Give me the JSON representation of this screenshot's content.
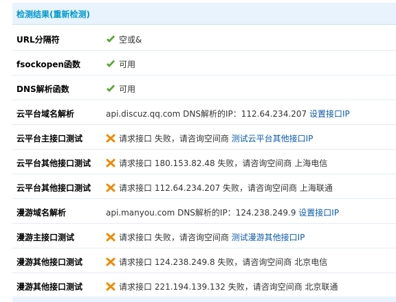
{
  "header": {
    "title_prefix": "检测结果(",
    "recheck_label": "重新检测",
    "title_suffix": ")"
  },
  "icons": {
    "ok": "check-icon",
    "fail": "cross-icon",
    "ok_color": "#5bb52b",
    "fail_color": "#f08a00"
  },
  "rows": [
    {
      "label": "URL分隔符",
      "status": "ok",
      "text": "空或&"
    },
    {
      "label": "fsockopen函数",
      "status": "ok",
      "text": "可用"
    },
    {
      "label": "DNS解析函数",
      "status": "ok",
      "text": "可用"
    },
    {
      "label": "云平台域名解析",
      "status": "none",
      "text": "api.discuz.qq.com DNS解析的IP：112.64.234.207 ",
      "link": "设置接口IP"
    },
    {
      "label": "云平台主接口测试",
      "status": "fail",
      "text": "请求接口 失败，请咨询空间商 ",
      "link": "测试云平台其他接口IP"
    },
    {
      "label": "云平台其他接口测试",
      "status": "fail",
      "text": "请求接口 180.153.82.48 失败，请咨询空间商 上海电信"
    },
    {
      "label": "云平台其他接口测试",
      "status": "fail",
      "text": "请求接口 112.64.234.207 失败，请咨询空间商 上海联通"
    },
    {
      "label": "漫游域名解析",
      "status": "none",
      "text": "api.manyou.com DNS解析的IP：124.238.249.9 ",
      "link": "设置接口IP"
    },
    {
      "label": "漫游主接口测试",
      "status": "fail",
      "text": "请求接口 失败，请咨询空间商 ",
      "link": "测试漫游其他接口IP"
    },
    {
      "label": "漫游其他接口测试",
      "status": "fail",
      "text": "请求接口 124.238.249.8 失败，请咨询空间商 北京电信"
    },
    {
      "label": "漫游其他接口测试",
      "status": "fail",
      "text": "请求接口 221.194.139.132 失败，请咨询空间商 北京联通"
    }
  ]
}
